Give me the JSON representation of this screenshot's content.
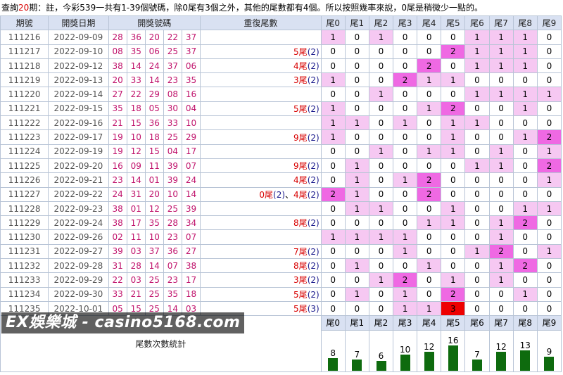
{
  "caption": {
    "prefix": "查詢",
    "count": "20",
    "suffix": "期：註，今彩539一共有1-39個號碼，除0尾有3個之外，其他的尾數都有4個。所以按照幾率來說，0尾是稍微少一點的。"
  },
  "headers": {
    "draw": "期號",
    "date": "開獎日期",
    "numbers": "開獎號碼",
    "repeat": "重復尾數",
    "tails": [
      "尾0",
      "尾1",
      "尾2",
      "尾3",
      "尾4",
      "尾5",
      "尾6",
      "尾7",
      "尾8",
      "尾9"
    ]
  },
  "rows": [
    {
      "draw": "111216",
      "date": "2022-09-09",
      "nums": [
        "28",
        "36",
        "20",
        "22",
        "37"
      ],
      "repeat": [],
      "tails": [
        "1",
        "0",
        "1",
        "0",
        "0",
        "0",
        "1",
        "1",
        "1",
        "0"
      ]
    },
    {
      "draw": "111217",
      "date": "2022-09-10",
      "nums": [
        "08",
        "35",
        "06",
        "25",
        "37"
      ],
      "repeat": [
        {
          "t": "5尾",
          "n": "(2)"
        }
      ],
      "tails": [
        "0",
        "0",
        "0",
        "0",
        "0",
        "2",
        "1",
        "1",
        "1",
        "0"
      ]
    },
    {
      "draw": "111218",
      "date": "2022-09-12",
      "nums": [
        "38",
        "14",
        "24",
        "37",
        "06"
      ],
      "repeat": [
        {
          "t": "4尾",
          "n": "(2)"
        }
      ],
      "tails": [
        "0",
        "0",
        "0",
        "0",
        "2",
        "0",
        "1",
        "1",
        "1",
        "0"
      ]
    },
    {
      "draw": "111219",
      "date": "2022-09-13",
      "nums": [
        "20",
        "33",
        "14",
        "23",
        "35"
      ],
      "repeat": [
        {
          "t": "3尾",
          "n": "(2)"
        }
      ],
      "tails": [
        "1",
        "0",
        "0",
        "2",
        "1",
        "1",
        "0",
        "0",
        "0",
        "0"
      ]
    },
    {
      "draw": "111220",
      "date": "2022-09-14",
      "nums": [
        "27",
        "22",
        "29",
        "08",
        "16"
      ],
      "repeat": [],
      "tails": [
        "0",
        "0",
        "1",
        "0",
        "0",
        "0",
        "1",
        "1",
        "1",
        "1"
      ]
    },
    {
      "draw": "111221",
      "date": "2022-09-15",
      "nums": [
        "35",
        "18",
        "05",
        "30",
        "04"
      ],
      "repeat": [
        {
          "t": "5尾",
          "n": "(2)"
        }
      ],
      "tails": [
        "1",
        "0",
        "0",
        "0",
        "1",
        "2",
        "0",
        "0",
        "1",
        "0"
      ]
    },
    {
      "draw": "111222",
      "date": "2022-09-16",
      "nums": [
        "21",
        "15",
        "36",
        "33",
        "10"
      ],
      "repeat": [],
      "tails": [
        "1",
        "1",
        "0",
        "1",
        "0",
        "1",
        "1",
        "0",
        "0",
        "0"
      ]
    },
    {
      "draw": "111223",
      "date": "2022-09-17",
      "nums": [
        "19",
        "10",
        "18",
        "25",
        "29"
      ],
      "repeat": [
        {
          "t": "9尾",
          "n": "(2)"
        }
      ],
      "tails": [
        "1",
        "0",
        "0",
        "0",
        "0",
        "1",
        "0",
        "0",
        "1",
        "2"
      ]
    },
    {
      "draw": "111224",
      "date": "2022-09-19",
      "nums": [
        "19",
        "12",
        "15",
        "04",
        "17"
      ],
      "repeat": [],
      "tails": [
        "0",
        "0",
        "1",
        "0",
        "1",
        "1",
        "0",
        "1",
        "0",
        "1"
      ]
    },
    {
      "draw": "111225",
      "date": "2022-09-20",
      "nums": [
        "16",
        "09",
        "11",
        "39",
        "07"
      ],
      "repeat": [
        {
          "t": "9尾",
          "n": "(2)"
        }
      ],
      "tails": [
        "0",
        "1",
        "0",
        "0",
        "0",
        "0",
        "1",
        "1",
        "0",
        "2"
      ]
    },
    {
      "draw": "111226",
      "date": "2022-09-21",
      "nums": [
        "23",
        "14",
        "01",
        "39",
        "24"
      ],
      "repeat": [
        {
          "t": "4尾",
          "n": "(2)"
        }
      ],
      "tails": [
        "0",
        "1",
        "0",
        "1",
        "2",
        "0",
        "0",
        "0",
        "0",
        "1"
      ]
    },
    {
      "draw": "111227",
      "date": "2022-09-22",
      "nums": [
        "24",
        "31",
        "20",
        "10",
        "14"
      ],
      "repeat": [
        {
          "t": "0尾",
          "n": "(2)"
        },
        {
          "t": "4尾",
          "n": "(2)"
        }
      ],
      "tails": [
        "2",
        "1",
        "0",
        "0",
        "2",
        "0",
        "0",
        "0",
        "0",
        "0"
      ]
    },
    {
      "draw": "111228",
      "date": "2022-09-23",
      "nums": [
        "38",
        "01",
        "12",
        "25",
        "39"
      ],
      "repeat": [],
      "tails": [
        "0",
        "1",
        "1",
        "0",
        "0",
        "1",
        "0",
        "0",
        "1",
        "1"
      ]
    },
    {
      "draw": "111229",
      "date": "2022-09-24",
      "nums": [
        "38",
        "17",
        "35",
        "28",
        "34"
      ],
      "repeat": [
        {
          "t": "8尾",
          "n": "(2)"
        }
      ],
      "tails": [
        "0",
        "0",
        "0",
        "0",
        "1",
        "1",
        "0",
        "1",
        "2",
        "0"
      ]
    },
    {
      "draw": "111230",
      "date": "2022-09-26",
      "nums": [
        "02",
        "11",
        "10",
        "23",
        "07"
      ],
      "repeat": [],
      "tails": [
        "1",
        "1",
        "1",
        "1",
        "0",
        "0",
        "0",
        "1",
        "0",
        "0"
      ]
    },
    {
      "draw": "111231",
      "date": "2022-09-27",
      "nums": [
        "39",
        "03",
        "37",
        "36",
        "27"
      ],
      "repeat": [
        {
          "t": "7尾",
          "n": "(2)"
        }
      ],
      "tails": [
        "0",
        "0",
        "0",
        "1",
        "0",
        "0",
        "1",
        "2",
        "0",
        "1"
      ]
    },
    {
      "draw": "111232",
      "date": "2022-09-28",
      "nums": [
        "31",
        "28",
        "14",
        "07",
        "38"
      ],
      "repeat": [
        {
          "t": "8尾",
          "n": "(2)"
        }
      ],
      "tails": [
        "0",
        "1",
        "0",
        "0",
        "1",
        "0",
        "0",
        "1",
        "2",
        "0"
      ]
    },
    {
      "draw": "111233",
      "date": "2022-09-29",
      "nums": [
        "22",
        "03",
        "25",
        "23",
        "17"
      ],
      "repeat": [
        {
          "t": "3尾",
          "n": "(2)"
        }
      ],
      "tails": [
        "0",
        "0",
        "1",
        "2",
        "0",
        "1",
        "0",
        "1",
        "0",
        "0"
      ]
    },
    {
      "draw": "111234",
      "date": "2022-09-30",
      "nums": [
        "33",
        "21",
        "25",
        "35",
        "18"
      ],
      "repeat": [
        {
          "t": "5尾",
          "n": "(2)"
        }
      ],
      "tails": [
        "0",
        "1",
        "0",
        "1",
        "0",
        "2",
        "0",
        "0",
        "1",
        "0"
      ]
    },
    {
      "draw": "111235",
      "date": "2022-10-01",
      "nums": [
        "05",
        "15",
        "25",
        "14",
        "03"
      ],
      "repeat": [
        {
          "t": "5尾",
          "n": "(3)"
        }
      ],
      "tails": [
        "0",
        "0",
        "0",
        "1",
        "1",
        "3",
        "0",
        "0",
        "0",
        "0"
      ]
    }
  ],
  "stats": {
    "label": "尾數次數統計",
    "headers": [
      "尾0",
      "尾1",
      "尾2",
      "尾3",
      "尾4",
      "尾5",
      "尾6",
      "尾7",
      "尾8",
      "尾9"
    ],
    "counts": [
      8,
      7,
      6,
      10,
      12,
      16,
      7,
      12,
      13,
      9
    ],
    "bar_color": "#0e6b0e"
  },
  "colors": {
    "zero": "#ffffff",
    "one": "#f6c8f2",
    "two": "#ef69e3",
    "three": "#ee0000"
  },
  "watermark": "EX娛樂城 - casino5168.com"
}
